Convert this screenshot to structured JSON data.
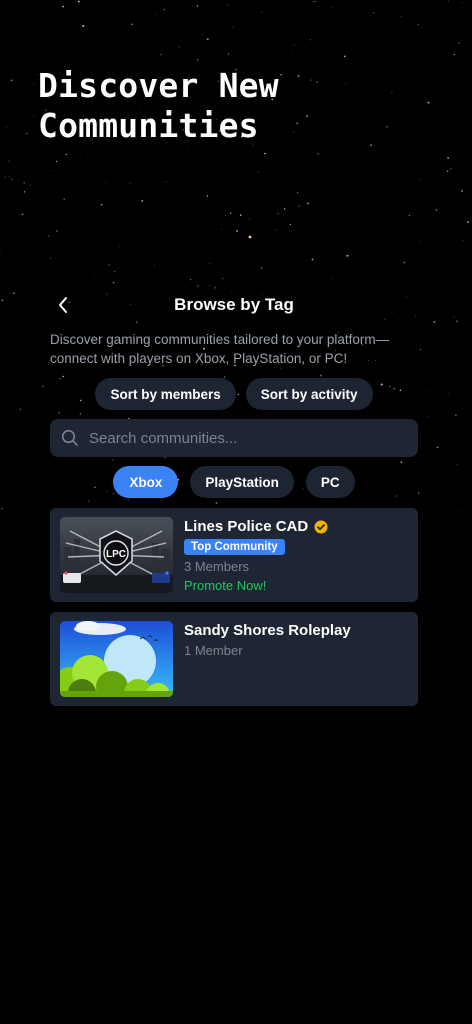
{
  "hero": {
    "title": "Discover New\nCommunities"
  },
  "header": {
    "title": "Browse by Tag"
  },
  "description": "Discover gaming communities tailored to your platform—connect with players on Xbox, PlayStation, or PC!",
  "sort": {
    "members_label": "Sort by members",
    "activity_label": "Sort by activity"
  },
  "search": {
    "placeholder": "Search communities..."
  },
  "tags": [
    {
      "label": "Xbox",
      "active": true
    },
    {
      "label": "PlayStation",
      "active": false
    },
    {
      "label": "PC",
      "active": false
    }
  ],
  "communities": [
    {
      "name": "Lines Police CAD",
      "verified": true,
      "badge": "Top Community",
      "members": "3 Members",
      "promote": "Promote Now!",
      "logo_text": "LPC"
    },
    {
      "name": "Sandy Shores Roleplay",
      "members": "1 Member"
    }
  ],
  "colors": {
    "accent": "#3b82f6",
    "success": "#22c55e",
    "verified": "#f5b301",
    "card": "#1f2633"
  }
}
